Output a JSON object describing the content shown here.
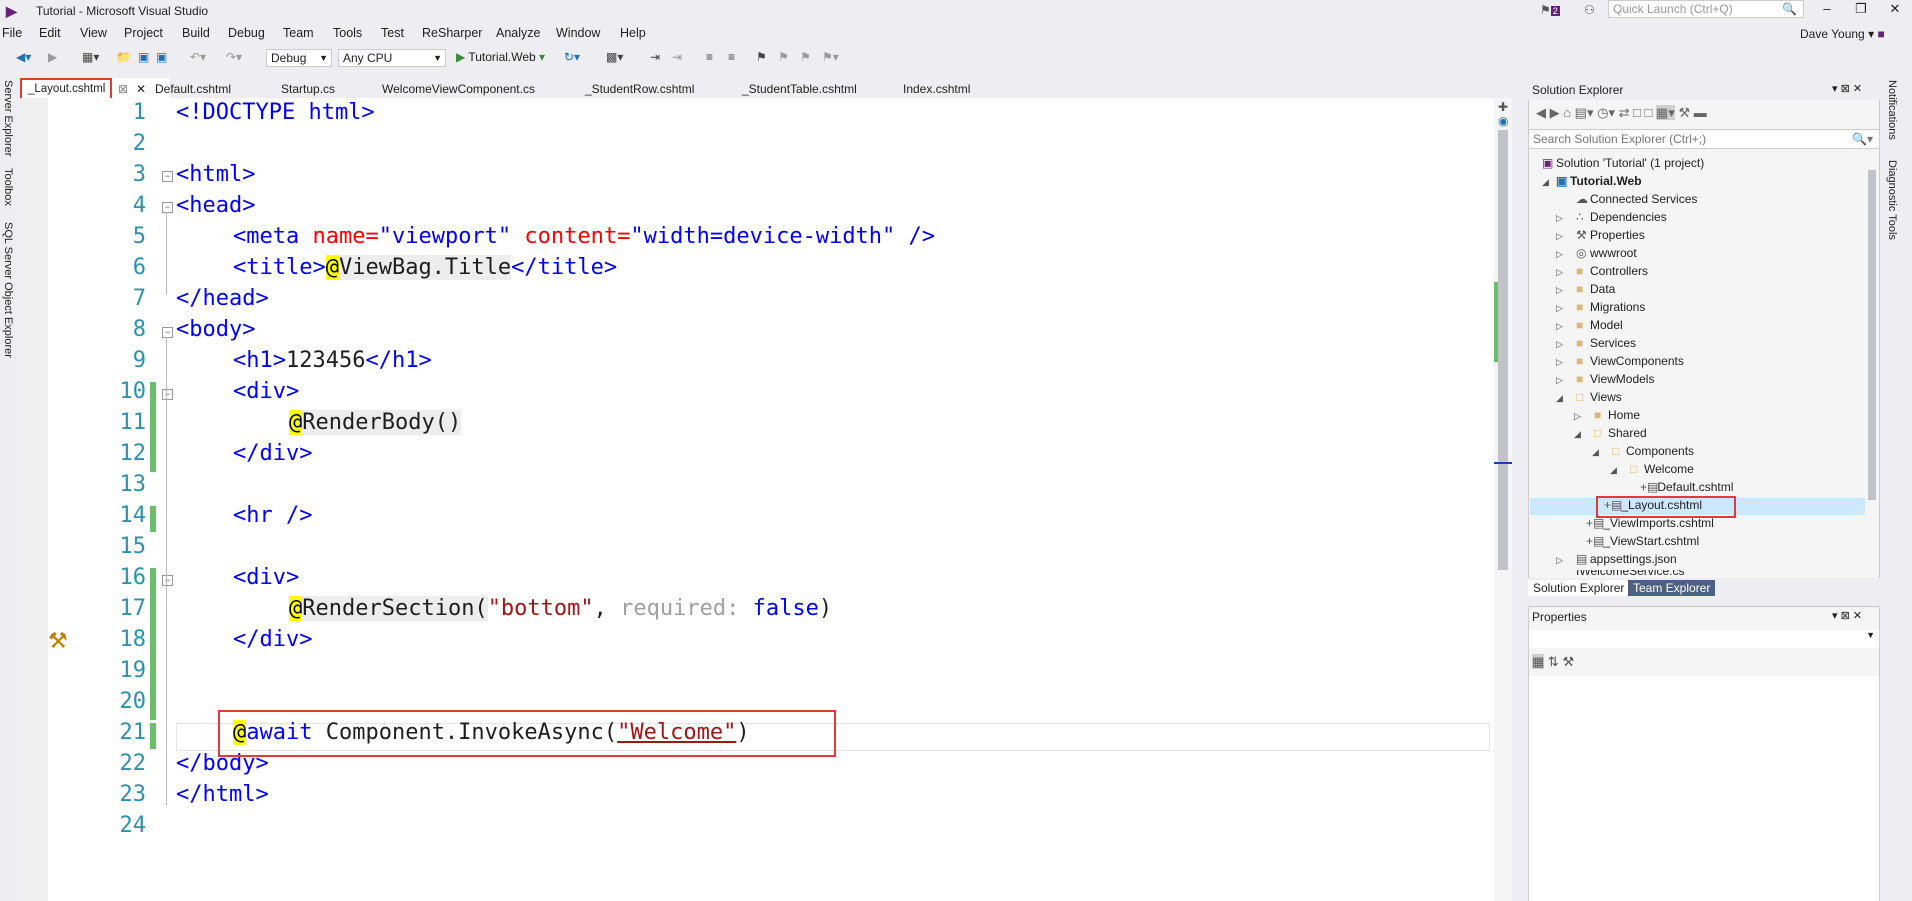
{
  "window": {
    "title": "Tutorial - Microsoft Visual Studio",
    "quick_launch_placeholder": "Quick Launch (Ctrl+Q)",
    "notification_count": "2",
    "user": "Dave Young"
  },
  "menu": [
    "File",
    "Edit",
    "View",
    "Project",
    "Build",
    "Debug",
    "Team",
    "Tools",
    "Test",
    "ReSharper",
    "Analyze",
    "Window",
    "Help"
  ],
  "toolbar": {
    "config": "Debug",
    "platform": "Any CPU",
    "run_target": "Tutorial.Web"
  },
  "left_rail": [
    "Server Explorer",
    "Toolbox",
    "SQL Server Object Explorer"
  ],
  "right_rail": [
    "Notifications",
    "Diagnostic Tools"
  ],
  "tabs": [
    {
      "label": "_Layout.cshtml",
      "active": true
    },
    {
      "label": "Default.cshtml"
    },
    {
      "label": "Startup.cs"
    },
    {
      "label": "WelcomeViewComponent.cs"
    },
    {
      "label": "_StudentRow.cshtml"
    },
    {
      "label": "_StudentTable.cshtml"
    },
    {
      "label": "Index.cshtml"
    }
  ],
  "code": {
    "line_numbers": [
      "1",
      "2",
      "3",
      "4",
      "5",
      "6",
      "7",
      "8",
      "9",
      "10",
      "11",
      "12",
      "13",
      "14",
      "15",
      "16",
      "17",
      "18",
      "19",
      "20",
      "21",
      "22",
      "23",
      "24"
    ],
    "l1": "<!DOCTYPE html>",
    "l3": "<html>",
    "l4": "<head>",
    "l5_a": "<meta ",
    "l5_b": "name=",
    "l5_c": "\"viewport\" ",
    "l5_d": "content=",
    "l5_e": "\"width=device-width\" ",
    "l5_f": "/>",
    "l6_a": "<title>",
    "l6_b": "@",
    "l6_c": "ViewBag.Title",
    "l6_d": "</title>",
    "l7": "</head>",
    "l8": "<body>",
    "l9_a": "<h1>",
    "l9_b": "123456",
    "l9_c": "</h1>",
    "l10": "<div>",
    "l11_a": "@",
    "l11_b": "RenderBody()",
    "l12": "</div>",
    "l14": "<hr />",
    "l16": "<div>",
    "l17_a": "@",
    "l17_b": "RenderSection(",
    "l17_c": "\"bottom\"",
    "l17_d": ", ",
    "l17_e": "required: ",
    "l17_f": "false",
    "l17_g": ")",
    "l18": "</div>",
    "l21_a": "@",
    "l21_b": "await",
    "l21_c": " Component.InvokeAsync(",
    "l21_d": "\"Welcome\"",
    "l21_e": ")",
    "l22": "</body>",
    "l23": "</html>"
  },
  "solution_explorer": {
    "title": "Solution Explorer",
    "search_placeholder": "Search Solution Explorer (Ctrl+;)",
    "items": [
      "Solution 'Tutorial' (1 project)",
      "Tutorial.Web",
      "Connected Services",
      "Dependencies",
      "Properties",
      "wwwroot",
      "Controllers",
      "Data",
      "Migrations",
      "Model",
      "Services",
      "ViewComponents",
      "ViewModels",
      "Views",
      "Home",
      "Shared",
      "Components",
      "Welcome",
      "Default.cshtml",
      "_Layout.cshtml",
      "_ViewImports.cshtml",
      "_ViewStart.cshtml",
      "appsettings.json",
      "IWelcomeService.cs"
    ],
    "bottom_tabs": [
      "Solution Explorer",
      "Team Explorer"
    ]
  },
  "properties": {
    "title": "Properties"
  },
  "colors": {
    "highlight_red": "#e53935",
    "razor_yellow": "#ffff00",
    "change_green": "#6bbf6b"
  }
}
